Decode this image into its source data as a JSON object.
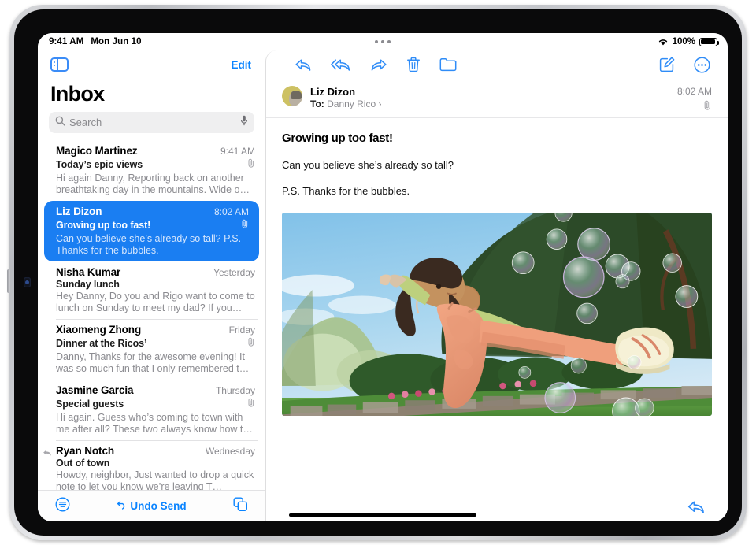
{
  "status_bar": {
    "time": "9:41 AM",
    "date": "Mon Jun 10",
    "battery_percent": "100%",
    "wifi_icon": "wifi-icon",
    "battery_icon": "battery-full-icon",
    "multitask_icon": "multitasking-dots-icon"
  },
  "sidebar": {
    "toggle_icon": "sidebar-toggle-icon",
    "edit_label": "Edit",
    "title": "Inbox",
    "search": {
      "placeholder": "Search",
      "search_icon": "search-icon",
      "dictate_icon": "microphone-icon"
    },
    "messages": [
      {
        "sender": "Magico Martinez",
        "time": "9:41 AM",
        "subject": "Today’s epic views",
        "preview": "Hi again Danny, Reporting back on another breathtaking day in the mountains. Wide o…",
        "attachment": true,
        "selected": false,
        "replied": false
      },
      {
        "sender": "Liz Dizon",
        "time": "8:02 AM",
        "subject": "Growing up too fast!",
        "preview": "Can you believe she’s already so tall? P.S. Thanks for the bubbles.",
        "attachment": true,
        "selected": true,
        "replied": false
      },
      {
        "sender": "Nisha Kumar",
        "time": "Yesterday",
        "subject": "Sunday lunch",
        "preview": "Hey Danny, Do you and Rigo want to come to lunch on Sunday to meet my dad? If you…",
        "attachment": false,
        "selected": false,
        "replied": false
      },
      {
        "sender": "Xiaomeng Zhong",
        "time": "Friday",
        "subject": "Dinner at the Ricos’",
        "preview": "Danny, Thanks for the awesome evening! It was so much fun that I only remembered t…",
        "attachment": true,
        "selected": false,
        "replied": false
      },
      {
        "sender": "Jasmine Garcia",
        "time": "Thursday",
        "subject": "Special guests",
        "preview": "Hi again. Guess who’s coming to town with me after all? These two always know how t…",
        "attachment": true,
        "selected": false,
        "replied": false
      },
      {
        "sender": "Ryan Notch",
        "time": "Wednesday",
        "subject": "Out of town",
        "preview": "Howdy, neighbor, Just wanted to drop a quick note to let you know we’re leaving T…",
        "attachment": false,
        "selected": false,
        "replied": true
      }
    ],
    "bottom_bar": {
      "filter_icon": "filter-icon",
      "undo_send_label": "Undo Send",
      "undo_icon": "undo-arrow-icon",
      "compose_stack_icon": "copy-stack-icon"
    }
  },
  "detail": {
    "toolbar": [
      {
        "name": "reply-button",
        "icon": "reply-icon"
      },
      {
        "name": "reply-all-button",
        "icon": "reply-all-icon"
      },
      {
        "name": "forward-button",
        "icon": "forward-icon"
      },
      {
        "name": "delete-button",
        "icon": "trash-icon"
      },
      {
        "name": "move-to-folder-button",
        "icon": "folder-icon"
      },
      {
        "name": "compose-button",
        "icon": "compose-icon"
      },
      {
        "name": "more-options-button",
        "icon": "ellipsis-circle-icon"
      }
    ],
    "header": {
      "from": "Liz Dizon",
      "to_label": "To:",
      "to_name": "Danny Rico",
      "disclosure": "›",
      "time": "8:02 AM",
      "attachment_icon": "paperclip-icon",
      "avatar_icon": "avatar"
    },
    "message": {
      "subject": "Growing up too fast!",
      "paragraphs": [
        "Can you believe she’s already so tall?",
        "P.S. Thanks for the bubbles."
      ],
      "photo_alt": "girl-kicking-with-bubbles-photo"
    },
    "bottom": {
      "reply_icon": "reply-icon"
    }
  },
  "colors": {
    "accent": "#0a84ff",
    "selection": "#1a7ef2",
    "secondary_text": "#8b8b90",
    "separator": "#e2e2e4"
  }
}
